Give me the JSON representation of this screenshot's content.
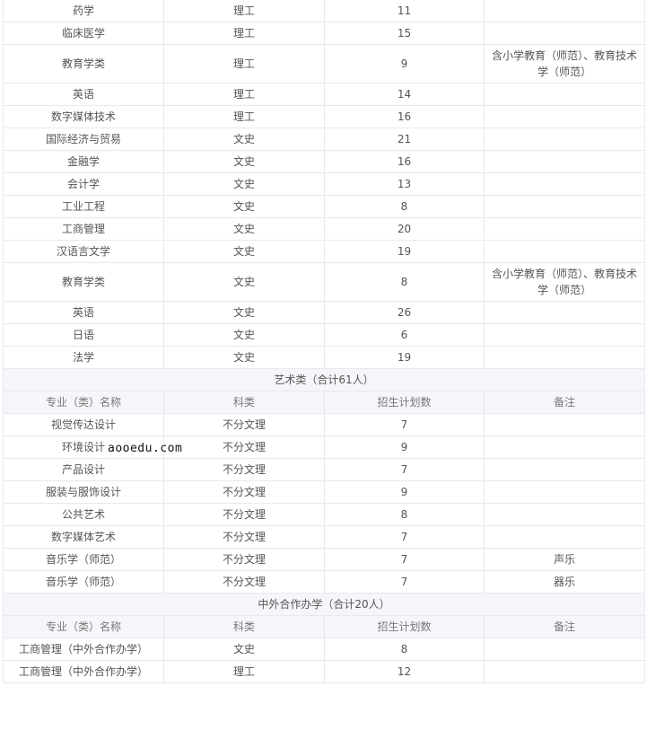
{
  "watermark": "aooedu.com",
  "top_rows": [
    {
      "name": "药学",
      "category": "理工",
      "quota": "11",
      "note": ""
    },
    {
      "name": "临床医学",
      "category": "理工",
      "quota": "15",
      "note": ""
    },
    {
      "name": "教育学类",
      "category": "理工",
      "quota": "9",
      "note": "含小学教育（师范）、教育技术学（师范）"
    },
    {
      "name": "英语",
      "category": "理工",
      "quota": "14",
      "note": ""
    },
    {
      "name": "数字媒体技术",
      "category": "理工",
      "quota": "16",
      "note": ""
    },
    {
      "name": "国际经济与贸易",
      "category": "文史",
      "quota": "21",
      "note": ""
    },
    {
      "name": "金融学",
      "category": "文史",
      "quota": "16",
      "note": ""
    },
    {
      "name": "会计学",
      "category": "文史",
      "quota": "13",
      "note": ""
    },
    {
      "name": "工业工程",
      "category": "文史",
      "quota": "8",
      "note": ""
    },
    {
      "name": "工商管理",
      "category": "文史",
      "quota": "20",
      "note": ""
    },
    {
      "name": "汉语言文学",
      "category": "文史",
      "quota": "19",
      "note": ""
    },
    {
      "name": "教育学类",
      "category": "文史",
      "quota": "8",
      "note": "含小学教育（师范）、教育技术学（师范）"
    },
    {
      "name": "英语",
      "category": "文史",
      "quota": "26",
      "note": ""
    },
    {
      "name": "日语",
      "category": "文史",
      "quota": "6",
      "note": ""
    },
    {
      "name": "法学",
      "category": "文史",
      "quota": "19",
      "note": ""
    }
  ],
  "columns": {
    "name": "专业（类）名称",
    "category": "科类",
    "quota": "招生计划数",
    "note": "备注"
  },
  "art_section": {
    "title": "艺术类（合计61人）",
    "rows": [
      {
        "name": "视觉传达设计",
        "category": "不分文理",
        "quota": "7",
        "note": ""
      },
      {
        "name": "环境设计",
        "category": "不分文理",
        "quota": "9",
        "note": ""
      },
      {
        "name": "产品设计",
        "category": "不分文理",
        "quota": "7",
        "note": ""
      },
      {
        "name": "服装与服饰设计",
        "category": "不分文理",
        "quota": "9",
        "note": ""
      },
      {
        "name": "公共艺术",
        "category": "不分文理",
        "quota": "8",
        "note": ""
      },
      {
        "name": "数字媒体艺术",
        "category": "不分文理",
        "quota": "7",
        "note": ""
      },
      {
        "name": "音乐学（师范）",
        "category": "不分文理",
        "quota": "7",
        "note": "声乐"
      },
      {
        "name": "音乐学（师范）",
        "category": "不分文理",
        "quota": "7",
        "note": "器乐"
      }
    ]
  },
  "coop_section": {
    "title": "中外合作办学（合计20人）",
    "rows": [
      {
        "name": "工商管理（中外合作办学）",
        "category": "文史",
        "quota": "8",
        "note": ""
      },
      {
        "name": "工商管理（中外合作办学）",
        "category": "理工",
        "quota": "12",
        "note": ""
      }
    ]
  }
}
